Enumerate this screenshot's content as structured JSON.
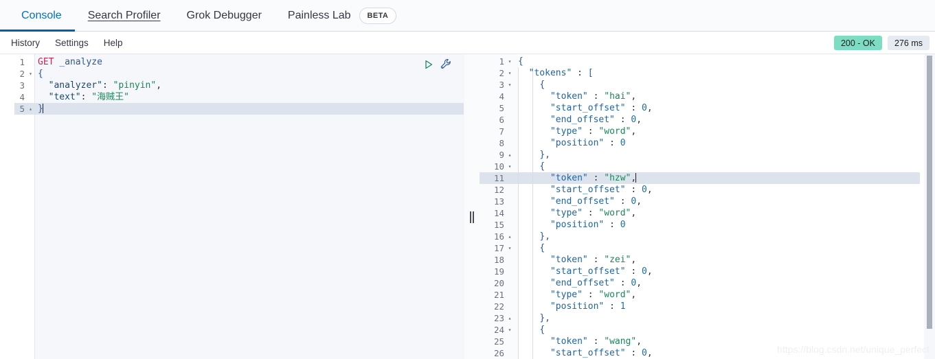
{
  "tabs": [
    {
      "label": "Console",
      "active": true,
      "underlined": false,
      "badge": null
    },
    {
      "label": "Search Profiler",
      "active": false,
      "underlined": true,
      "badge": null
    },
    {
      "label": "Grok Debugger",
      "active": false,
      "underlined": false,
      "badge": null
    },
    {
      "label": "Painless Lab",
      "active": false,
      "underlined": false,
      "badge": "BETA"
    }
  ],
  "toolbar": {
    "history_label": "History",
    "settings_label": "Settings",
    "help_label": "Help"
  },
  "status": {
    "code_label": "200 - OK",
    "time_label": "276 ms",
    "ok_color": "#7dddc3",
    "time_color": "#e6ebf2"
  },
  "request": {
    "play_title": "Click to send request",
    "wrench_title": "Open documentation",
    "active_line": 5,
    "lines": [
      {
        "n": 1,
        "fold": "",
        "tokens": [
          {
            "t": "GET",
            "c": "tok-method"
          },
          {
            "t": " ",
            "c": "tok-punct"
          },
          {
            "t": "_analyze",
            "c": "tok-url"
          }
        ]
      },
      {
        "n": 2,
        "fold": "▾",
        "tokens": [
          {
            "t": "{",
            "c": "tok-brace"
          }
        ]
      },
      {
        "n": 3,
        "fold": "",
        "tokens": [
          {
            "t": "  ",
            "c": "tok-punct"
          },
          {
            "t": "\"analyzer\"",
            "c": "tok-key-d"
          },
          {
            "t": ": ",
            "c": "tok-punct"
          },
          {
            "t": "\"pinyin\"",
            "c": "tok-str"
          },
          {
            "t": ",",
            "c": "tok-punct"
          }
        ]
      },
      {
        "n": 4,
        "fold": "",
        "tokens": [
          {
            "t": "  ",
            "c": "tok-punct"
          },
          {
            "t": "\"text\"",
            "c": "tok-key-d"
          },
          {
            "t": ": ",
            "c": "tok-punct"
          },
          {
            "t": "\"海贼王\"",
            "c": "tok-str"
          }
        ]
      },
      {
        "n": 5,
        "fold": "▴",
        "tokens": [
          {
            "t": "}",
            "c": "tok-brace"
          }
        ],
        "caret": true
      }
    ]
  },
  "response": {
    "active_line": 11,
    "lines": [
      {
        "n": 1,
        "fold": "▾",
        "tokens": [
          {
            "t": "{",
            "c": "tok-brace"
          }
        ]
      },
      {
        "n": 2,
        "fold": "▾",
        "tokens": [
          {
            "t": "  ",
            "c": "tok-punct"
          },
          {
            "t": "\"tokens\"",
            "c": "tok-key"
          },
          {
            "t": " : ",
            "c": "tok-punct"
          },
          {
            "t": "[",
            "c": "tok-brace"
          }
        ]
      },
      {
        "n": 3,
        "fold": "▾",
        "tokens": [
          {
            "t": "    ",
            "c": "tok-punct"
          },
          {
            "t": "{",
            "c": "tok-brace"
          }
        ]
      },
      {
        "n": 4,
        "fold": "",
        "tokens": [
          {
            "t": "      ",
            "c": "tok-punct"
          },
          {
            "t": "\"token\"",
            "c": "tok-key"
          },
          {
            "t": " : ",
            "c": "tok-punct"
          },
          {
            "t": "\"hai\"",
            "c": "tok-str"
          },
          {
            "t": ",",
            "c": "tok-punct"
          }
        ]
      },
      {
        "n": 5,
        "fold": "",
        "tokens": [
          {
            "t": "      ",
            "c": "tok-punct"
          },
          {
            "t": "\"start_offset\"",
            "c": "tok-key"
          },
          {
            "t": " : ",
            "c": "tok-punct"
          },
          {
            "t": "0",
            "c": "tok-num"
          },
          {
            "t": ",",
            "c": "tok-punct"
          }
        ]
      },
      {
        "n": 6,
        "fold": "",
        "tokens": [
          {
            "t": "      ",
            "c": "tok-punct"
          },
          {
            "t": "\"end_offset\"",
            "c": "tok-key"
          },
          {
            "t": " : ",
            "c": "tok-punct"
          },
          {
            "t": "0",
            "c": "tok-num"
          },
          {
            "t": ",",
            "c": "tok-punct"
          }
        ]
      },
      {
        "n": 7,
        "fold": "",
        "tokens": [
          {
            "t": "      ",
            "c": "tok-punct"
          },
          {
            "t": "\"type\"",
            "c": "tok-key"
          },
          {
            "t": " : ",
            "c": "tok-punct"
          },
          {
            "t": "\"word\"",
            "c": "tok-str"
          },
          {
            "t": ",",
            "c": "tok-punct"
          }
        ]
      },
      {
        "n": 8,
        "fold": "",
        "tokens": [
          {
            "t": "      ",
            "c": "tok-punct"
          },
          {
            "t": "\"position\"",
            "c": "tok-key"
          },
          {
            "t": " : ",
            "c": "tok-punct"
          },
          {
            "t": "0",
            "c": "tok-num"
          }
        ]
      },
      {
        "n": 9,
        "fold": "▴",
        "tokens": [
          {
            "t": "    ",
            "c": "tok-punct"
          },
          {
            "t": "},",
            "c": "tok-brace"
          }
        ]
      },
      {
        "n": 10,
        "fold": "▾",
        "tokens": [
          {
            "t": "    ",
            "c": "tok-punct"
          },
          {
            "t": "{",
            "c": "tok-brace"
          }
        ]
      },
      {
        "n": 11,
        "fold": "",
        "tokens": [
          {
            "t": "      ",
            "c": "tok-punct"
          },
          {
            "t": "\"token\"",
            "c": "tok-key"
          },
          {
            "t": " : ",
            "c": "tok-punct"
          },
          {
            "t": "\"hzw\"",
            "c": "tok-str"
          },
          {
            "t": ",",
            "c": "tok-punct"
          }
        ],
        "caret": true
      },
      {
        "n": 12,
        "fold": "",
        "tokens": [
          {
            "t": "      ",
            "c": "tok-punct"
          },
          {
            "t": "\"start_offset\"",
            "c": "tok-key"
          },
          {
            "t": " : ",
            "c": "tok-punct"
          },
          {
            "t": "0",
            "c": "tok-num"
          },
          {
            "t": ",",
            "c": "tok-punct"
          }
        ]
      },
      {
        "n": 13,
        "fold": "",
        "tokens": [
          {
            "t": "      ",
            "c": "tok-punct"
          },
          {
            "t": "\"end_offset\"",
            "c": "tok-key"
          },
          {
            "t": " : ",
            "c": "tok-punct"
          },
          {
            "t": "0",
            "c": "tok-num"
          },
          {
            "t": ",",
            "c": "tok-punct"
          }
        ]
      },
      {
        "n": 14,
        "fold": "",
        "tokens": [
          {
            "t": "      ",
            "c": "tok-punct"
          },
          {
            "t": "\"type\"",
            "c": "tok-key"
          },
          {
            "t": " : ",
            "c": "tok-punct"
          },
          {
            "t": "\"word\"",
            "c": "tok-str"
          },
          {
            "t": ",",
            "c": "tok-punct"
          }
        ]
      },
      {
        "n": 15,
        "fold": "",
        "tokens": [
          {
            "t": "      ",
            "c": "tok-punct"
          },
          {
            "t": "\"position\"",
            "c": "tok-key"
          },
          {
            "t": " : ",
            "c": "tok-punct"
          },
          {
            "t": "0",
            "c": "tok-num"
          }
        ]
      },
      {
        "n": 16,
        "fold": "▴",
        "tokens": [
          {
            "t": "    ",
            "c": "tok-punct"
          },
          {
            "t": "},",
            "c": "tok-brace"
          }
        ]
      },
      {
        "n": 17,
        "fold": "▾",
        "tokens": [
          {
            "t": "    ",
            "c": "tok-punct"
          },
          {
            "t": "{",
            "c": "tok-brace"
          }
        ]
      },
      {
        "n": 18,
        "fold": "",
        "tokens": [
          {
            "t": "      ",
            "c": "tok-punct"
          },
          {
            "t": "\"token\"",
            "c": "tok-key"
          },
          {
            "t": " : ",
            "c": "tok-punct"
          },
          {
            "t": "\"zei\"",
            "c": "tok-str"
          },
          {
            "t": ",",
            "c": "tok-punct"
          }
        ]
      },
      {
        "n": 19,
        "fold": "",
        "tokens": [
          {
            "t": "      ",
            "c": "tok-punct"
          },
          {
            "t": "\"start_offset\"",
            "c": "tok-key"
          },
          {
            "t": " : ",
            "c": "tok-punct"
          },
          {
            "t": "0",
            "c": "tok-num"
          },
          {
            "t": ",",
            "c": "tok-punct"
          }
        ]
      },
      {
        "n": 20,
        "fold": "",
        "tokens": [
          {
            "t": "      ",
            "c": "tok-punct"
          },
          {
            "t": "\"end_offset\"",
            "c": "tok-key"
          },
          {
            "t": " : ",
            "c": "tok-punct"
          },
          {
            "t": "0",
            "c": "tok-num"
          },
          {
            "t": ",",
            "c": "tok-punct"
          }
        ]
      },
      {
        "n": 21,
        "fold": "",
        "tokens": [
          {
            "t": "      ",
            "c": "tok-punct"
          },
          {
            "t": "\"type\"",
            "c": "tok-key"
          },
          {
            "t": " : ",
            "c": "tok-punct"
          },
          {
            "t": "\"word\"",
            "c": "tok-str"
          },
          {
            "t": ",",
            "c": "tok-punct"
          }
        ]
      },
      {
        "n": 22,
        "fold": "",
        "tokens": [
          {
            "t": "      ",
            "c": "tok-punct"
          },
          {
            "t": "\"position\"",
            "c": "tok-key"
          },
          {
            "t": " : ",
            "c": "tok-punct"
          },
          {
            "t": "1",
            "c": "tok-num"
          }
        ]
      },
      {
        "n": 23,
        "fold": "▴",
        "tokens": [
          {
            "t": "    ",
            "c": "tok-punct"
          },
          {
            "t": "},",
            "c": "tok-brace"
          }
        ]
      },
      {
        "n": 24,
        "fold": "▾",
        "tokens": [
          {
            "t": "    ",
            "c": "tok-punct"
          },
          {
            "t": "{",
            "c": "tok-brace"
          }
        ]
      },
      {
        "n": 25,
        "fold": "",
        "tokens": [
          {
            "t": "      ",
            "c": "tok-punct"
          },
          {
            "t": "\"token\"",
            "c": "tok-key"
          },
          {
            "t": " : ",
            "c": "tok-punct"
          },
          {
            "t": "\"wang\"",
            "c": "tok-str"
          },
          {
            "t": ",",
            "c": "tok-punct"
          }
        ]
      },
      {
        "n": 26,
        "fold": "",
        "tokens": [
          {
            "t": "      ",
            "c": "tok-punct"
          },
          {
            "t": "\"start_offset\"",
            "c": "tok-key"
          },
          {
            "t": " : ",
            "c": "tok-punct"
          },
          {
            "t": "0",
            "c": "tok-num"
          },
          {
            "t": ",",
            "c": "tok-punct"
          }
        ]
      }
    ]
  },
  "watermark": {
    "text": "https://blog.csdn.net/unique_perfect"
  }
}
